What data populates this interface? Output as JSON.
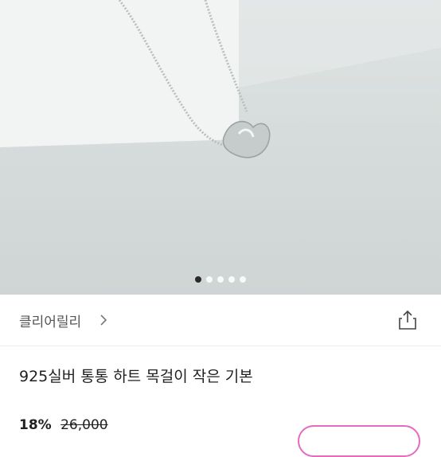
{
  "gallery": {
    "image_alt": "heart necklace",
    "dot_count": 5,
    "active_index": 0
  },
  "seller": {
    "name": "클리어릴리"
  },
  "product": {
    "title": "925실버 통통 하트 목걸이 작은 기본",
    "discount": "18%",
    "original_price": "26,000"
  },
  "icons": {
    "share": "share-icon",
    "chevron": "chevron-right-icon"
  },
  "colors": {
    "accent": "#e56ac0",
    "active_dot": "#2a2a2a"
  }
}
